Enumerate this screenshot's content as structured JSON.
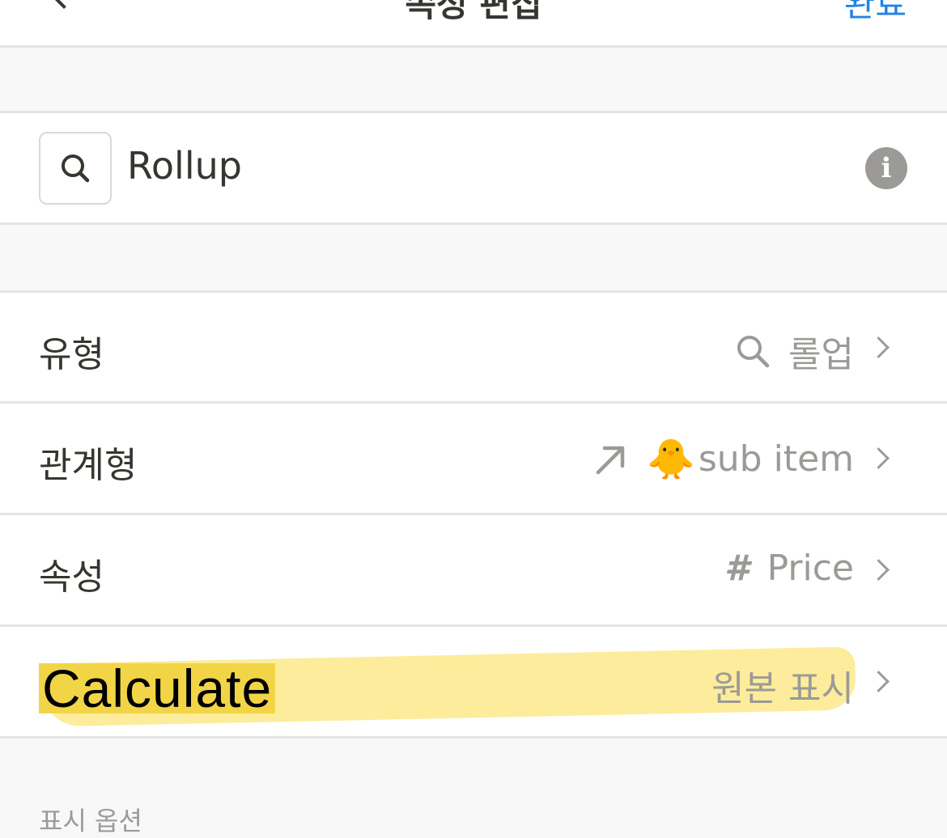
{
  "nav": {
    "title": "속성 편집",
    "done_label": "완료"
  },
  "property_name": {
    "value": "Rollup"
  },
  "rows": {
    "type": {
      "label": "유형",
      "value": "롤업"
    },
    "relation": {
      "label": "관계형",
      "emoji": "🐥",
      "value": "sub item"
    },
    "property": {
      "label": "속성",
      "symbol": "#",
      "value": "Price"
    },
    "calculate": {
      "label": "Calculate",
      "value": "원본 표시"
    }
  },
  "section": {
    "display_options": "표시 옵션"
  },
  "colors": {
    "accent": "#2383e2",
    "highlight": "#f2d547",
    "muted_text": "#9b9a97"
  }
}
